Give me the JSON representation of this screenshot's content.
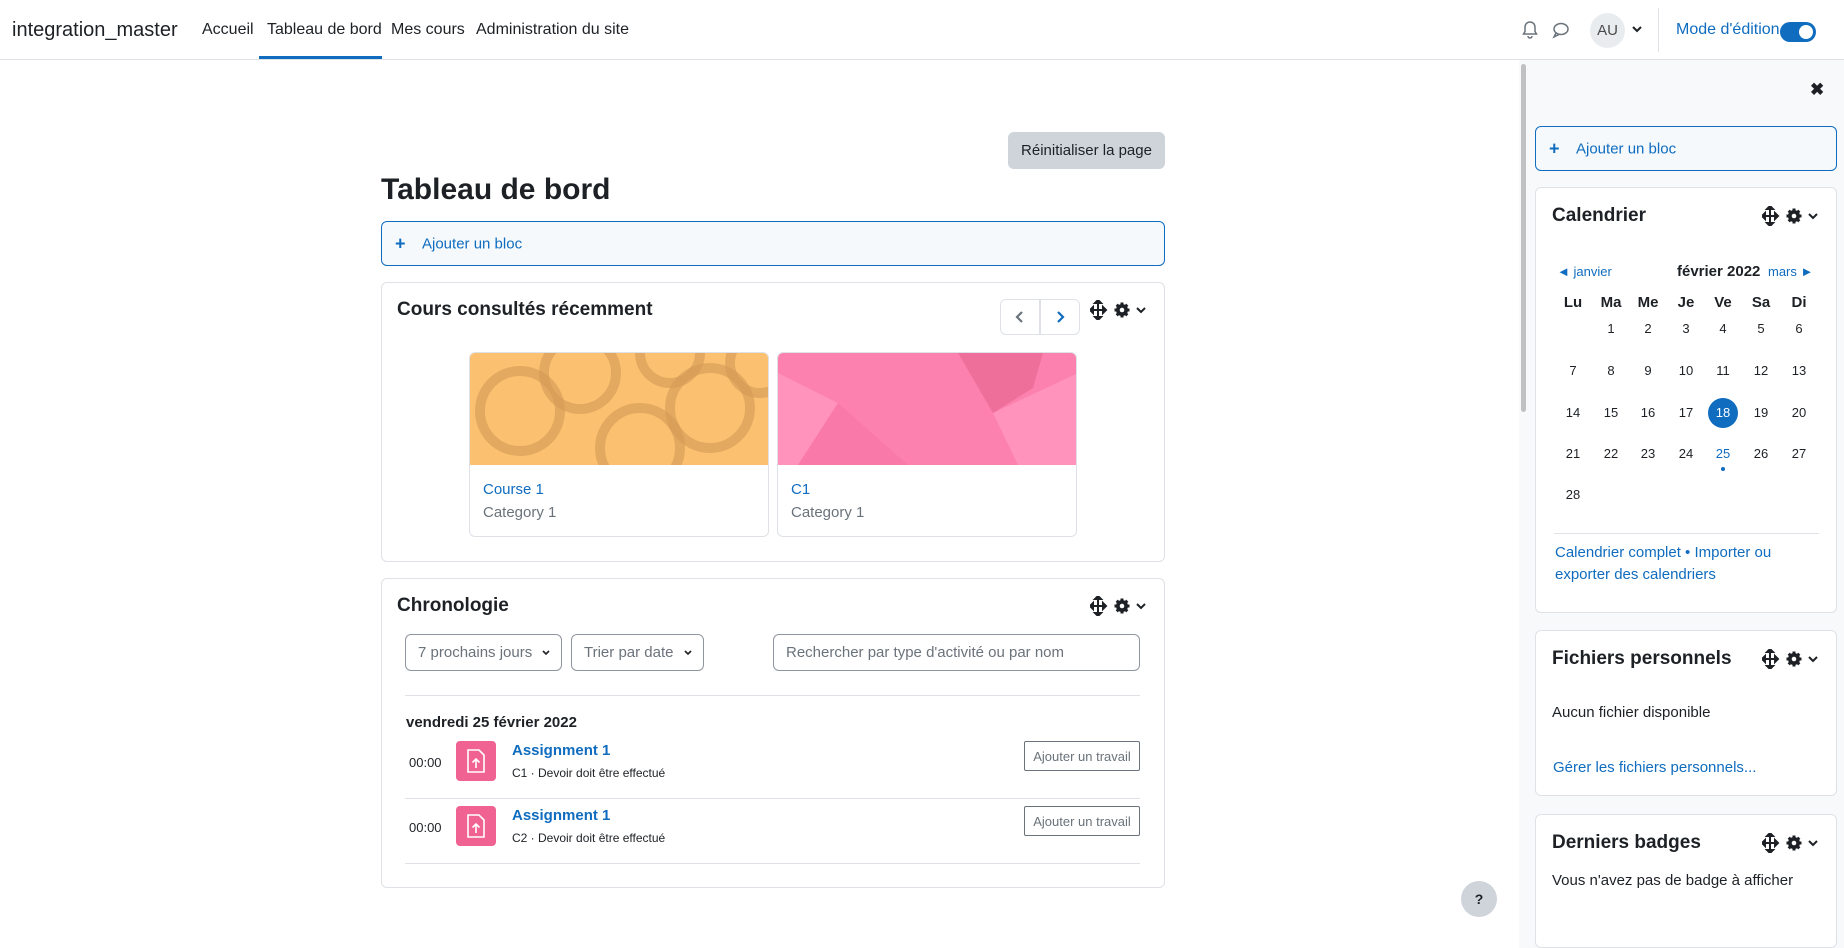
{
  "navbar": {
    "brand": "integration_master",
    "items": [
      "Accueil",
      "Tableau de bord",
      "Mes cours",
      "Administration du site"
    ],
    "avatar_initials": "AU",
    "edit_mode_label": "Mode d'édition",
    "edit_mode_on": true
  },
  "main": {
    "reset_button": "Réinitialiser la page",
    "title": "Tableau de bord",
    "add_block": "Ajouter un bloc",
    "recent": {
      "title": "Cours consultés récemment",
      "courses": [
        {
          "name": "Course 1",
          "category": "Category 1",
          "color": "#fcc170"
        },
        {
          "name": "C1",
          "category": "Category 1",
          "color": "#fd81ae"
        }
      ]
    },
    "timeline": {
      "title": "Chronologie",
      "filter_select": "7 prochains jours",
      "sort_select": "Trier par date",
      "search_placeholder": "Rechercher par type d'activité ou par nom",
      "date_heading": "vendredi 25 février 2022",
      "events": [
        {
          "time": "00:00",
          "title": "Assignment 1",
          "subtitle": "C1 · Devoir doit être effectué",
          "action": "Ajouter un travail"
        },
        {
          "time": "00:00",
          "title": "Assignment 1",
          "subtitle": "C2 · Devoir doit être effectué",
          "action": "Ajouter un travail"
        }
      ]
    },
    "help_button": "?"
  },
  "drawer": {
    "add_block": "Ajouter un bloc",
    "calendar": {
      "title": "Calendrier",
      "prev_month": "◄ janvier",
      "current_month": "février 2022",
      "next_month": "mars ►",
      "weekdays": [
        "Lu",
        "Ma",
        "Me",
        "Je",
        "Ve",
        "Sa",
        "Di"
      ],
      "start_offset": 1,
      "days_in_month": 28,
      "today": 18,
      "event_days": [
        25
      ],
      "footer_link": "Calendrier complet • Importer ou exporter des calendriers"
    },
    "files": {
      "title": "Fichiers personnels",
      "empty": "Aucun fichier disponible",
      "manage_link": "Gérer les fichiers personnels..."
    },
    "badges": {
      "title": "Derniers badges",
      "empty": "Vous n'avez pas de badge à afficher"
    }
  },
  "colors": {
    "accent": "#0f6cbf",
    "assignment_icon": "#f06292"
  }
}
